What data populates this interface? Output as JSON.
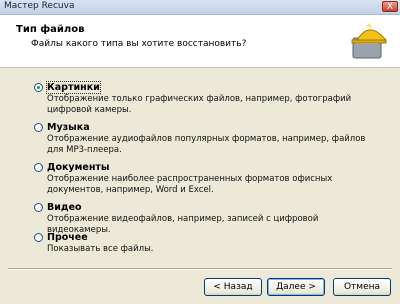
{
  "window": {
    "title": "Мастер Recuva",
    "close_glyph": "X"
  },
  "header": {
    "title": "Тип файлов",
    "subtitle": "Файлы какого типа вы хотите восстановить?",
    "logo_icon": "recuva-hardhat-drive-icon"
  },
  "options": [
    {
      "label": "Картинки",
      "description": "Отображение только графических файлов, например, фотографий цифровой камеры.",
      "selected": true
    },
    {
      "label": "Музыка",
      "description": "Отображение аудиофайлов популярных форматов, например, файлов для MP3-плеера.",
      "selected": false
    },
    {
      "label": "Документы",
      "description": "Отображение наиболее распространенных форматов офисных документов, например, Word и Excel.",
      "selected": false
    },
    {
      "label": "Видео",
      "description": "Отображение видеофайлов, например, записей с цифровой видеокамеры.",
      "selected": false
    },
    {
      "label": "Прочее",
      "description": "Показывать все файлы.",
      "selected": false
    }
  ],
  "buttons": {
    "back": "< Назад",
    "next": "Далее >",
    "cancel": "Отмена"
  },
  "colors": {
    "accent": "#21a121",
    "title_bar": "#c4d1e6",
    "button_border": "#003c74"
  }
}
